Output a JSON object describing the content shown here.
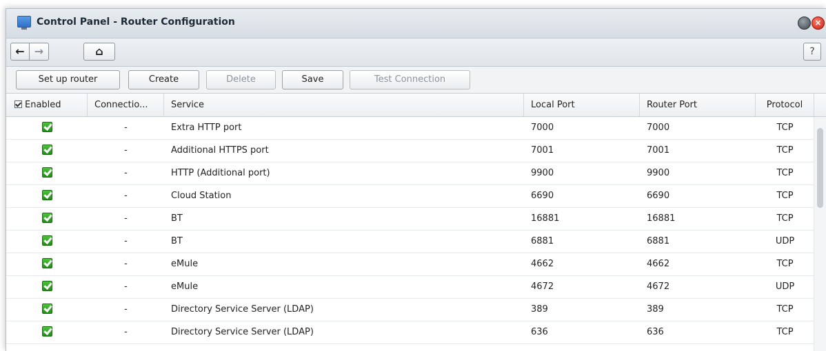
{
  "window": {
    "title": "Control Panel - Router Configuration",
    "close_glyph": "×"
  },
  "nav": {
    "back_glyph": "←",
    "forward_glyph": "→",
    "home_glyph": "⌂",
    "help_glyph": "?"
  },
  "toolbar": {
    "setup_label": "Set up router",
    "create_label": "Create",
    "delete_label": "Delete",
    "save_label": "Save",
    "test_label": "Test Connection"
  },
  "columns": {
    "enabled": "Enabled",
    "connection": "Connectio...",
    "service": "Service",
    "local_port": "Local Port",
    "router_port": "Router Port",
    "protocol": "Protocol"
  },
  "rows": [
    {
      "connection": "-",
      "service": "Extra HTTP port",
      "local_port": "7000",
      "router_port": "7000",
      "protocol": "TCP"
    },
    {
      "connection": "-",
      "service": "Additional HTTPS port",
      "local_port": "7001",
      "router_port": "7001",
      "protocol": "TCP"
    },
    {
      "connection": "-",
      "service": "HTTP (Additional port)",
      "local_port": "9900",
      "router_port": "9900",
      "protocol": "TCP"
    },
    {
      "connection": "-",
      "service": "Cloud Station",
      "local_port": "6690",
      "router_port": "6690",
      "protocol": "TCP"
    },
    {
      "connection": "-",
      "service": "BT",
      "local_port": "16881",
      "router_port": "16881",
      "protocol": "TCP"
    },
    {
      "connection": "-",
      "service": "BT",
      "local_port": "6881",
      "router_port": "6881",
      "protocol": "UDP"
    },
    {
      "connection": "-",
      "service": "eMule",
      "local_port": "4662",
      "router_port": "4662",
      "protocol": "TCP"
    },
    {
      "connection": "-",
      "service": "eMule",
      "local_port": "4672",
      "router_port": "4672",
      "protocol": "UDP"
    },
    {
      "connection": "-",
      "service": "Directory Service Server (LDAP)",
      "local_port": "389",
      "router_port": "389",
      "protocol": "TCP"
    },
    {
      "connection": "-",
      "service": "Directory Service Server (LDAP)",
      "local_port": "636",
      "router_port": "636",
      "protocol": "TCP"
    }
  ]
}
